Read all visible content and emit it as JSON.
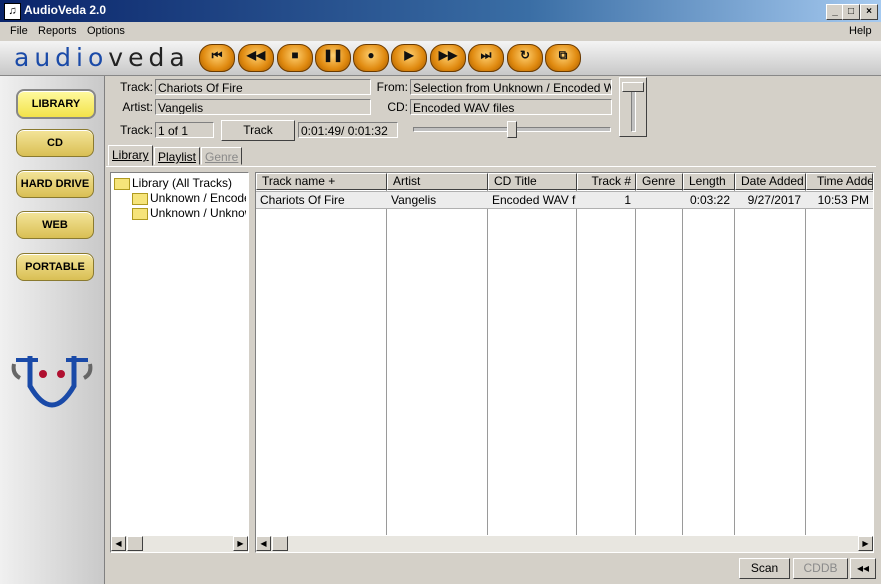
{
  "window": {
    "title": "AudioVeda 2.0",
    "controls": [
      "_",
      "□",
      "×"
    ]
  },
  "menu": {
    "file": "File",
    "reports": "Reports",
    "options": "Options",
    "help": "Help"
  },
  "logo": {
    "part1": "audio",
    "part2": "veda"
  },
  "nav": {
    "library": "LIBRARY",
    "cd": "CD",
    "hard_drive": "HARD DRIVE",
    "web": "WEB",
    "portable": "PORTABLE"
  },
  "player": {
    "track_label": "Track:",
    "track_value": "Chariots Of Fire",
    "artist_label": "Artist:",
    "artist_value": "Vangelis",
    "from_label": "From:",
    "from_value": "Selection from Unknown / Encoded WAV files",
    "cd_label": "CD:",
    "cd_value": "Encoded WAV files",
    "tracknum_label": "Track:",
    "tracknum_value": "1 of 1",
    "track_button": "Track",
    "time_value": "0:01:49/ 0:01:32",
    "position": 0.5,
    "volume": 1.0
  },
  "tabs": {
    "library": "Library",
    "playlist": "Playlist",
    "genre": "Genre"
  },
  "tree": {
    "root": "Library (All Tracks)",
    "child1": "Unknown / Encoded WAV files",
    "child2": "Unknown / Unknown"
  },
  "table": {
    "headers": [
      "Track name +",
      "Artist",
      "CD Title",
      "Track #",
      "Genre",
      "Length",
      "Date Added",
      "Time Added"
    ],
    "rows": [
      [
        "Chariots Of Fire",
        "Vangelis",
        "Encoded WAV files",
        "1",
        "",
        "0:03:22",
        "9/27/2017",
        "10:53 PM"
      ]
    ]
  },
  "footer": {
    "scan": "Scan",
    "cddb": "CDDB",
    "collapse": "◂◂"
  },
  "colors": {
    "titlebar": "#0a246a",
    "accent_button": "#e08a10",
    "nav_button": "#f2e24a"
  }
}
